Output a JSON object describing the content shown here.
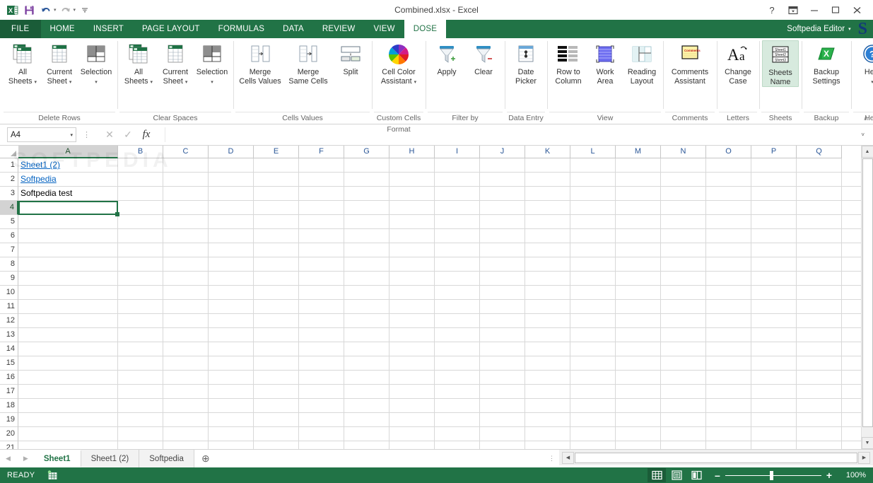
{
  "window": {
    "title": "Combined.xlsx - Excel",
    "app_icon": "excel-icon",
    "help_btn": "?",
    "ribbon_display_btn": "ribbon-display-options-icon",
    "minimize_btn": "–",
    "maximize_btn": "▫",
    "close_btn": "✕"
  },
  "quick_access": {
    "items": [
      {
        "name": "save-icon",
        "glyph": "save"
      },
      {
        "name": "undo-icon",
        "glyph": "undo",
        "caret": "▾"
      },
      {
        "name": "redo-icon",
        "glyph": "redo",
        "caret": "▾"
      },
      {
        "name": "customize-qat-icon",
        "glyph": "customize",
        "caret": ""
      }
    ]
  },
  "ribbon_tabs": {
    "file": "FILE",
    "items": [
      {
        "label": "HOME",
        "active": false
      },
      {
        "label": "INSERT",
        "active": false
      },
      {
        "label": "PAGE LAYOUT",
        "active": false
      },
      {
        "label": "FORMULAS",
        "active": false
      },
      {
        "label": "DATA",
        "active": false
      },
      {
        "label": "REVIEW",
        "active": false
      },
      {
        "label": "VIEW",
        "active": false
      },
      {
        "label": "DOSE",
        "active": true
      }
    ],
    "user": "Softpedia Editor",
    "user_caret": "▾",
    "brand_logo": "S",
    "collapse_icon": "∧"
  },
  "ribbon_groups": [
    {
      "label": "Delete Rows",
      "items": [
        {
          "line1": "All",
          "line2": "Sheets",
          "dropdown": true,
          "icon": "all-sheets-icon"
        },
        {
          "line1": "Current",
          "line2": "Sheet",
          "dropdown": true,
          "icon": "current-sheet-icon"
        },
        {
          "line1": "Selection",
          "line2": "",
          "dropdown": true,
          "icon": "selection-icon"
        }
      ]
    },
    {
      "label": "Clear Spaces",
      "items": [
        {
          "line1": "All",
          "line2": "Sheets",
          "dropdown": true,
          "icon": "all-sheets-icon"
        },
        {
          "line1": "Current",
          "line2": "Sheet",
          "dropdown": true,
          "icon": "current-sheet-icon"
        },
        {
          "line1": "Selection",
          "line2": "",
          "dropdown": true,
          "icon": "selection-icon"
        }
      ]
    },
    {
      "label": "Cells Values",
      "items": [
        {
          "line1": "Merge",
          "line2": "Cells Values",
          "dropdown": false,
          "icon": "merge-cells-values-icon"
        },
        {
          "line1": "Merge",
          "line2": "Same Cells",
          "dropdown": false,
          "icon": "merge-same-cells-icon"
        },
        {
          "line1": "Split",
          "line2": "",
          "dropdown": false,
          "icon": "split-icon"
        }
      ]
    },
    {
      "label": "Custom Cells Format",
      "items": [
        {
          "line1": "Cell Color",
          "line2": "Assistant",
          "dropdown": true,
          "icon": "color-wheel-icon"
        }
      ]
    },
    {
      "label": "Filter by",
      "items": [
        {
          "line1": "Apply",
          "line2": "",
          "dropdown": false,
          "icon": "filter-apply-icon"
        },
        {
          "line1": "Clear",
          "line2": "",
          "dropdown": false,
          "icon": "filter-clear-icon"
        }
      ]
    },
    {
      "label": "Data Entry",
      "items": [
        {
          "line1": "Date",
          "line2": "Picker",
          "dropdown": false,
          "icon": "date-picker-icon"
        }
      ]
    },
    {
      "label": "View",
      "items": [
        {
          "line1": "Row to",
          "line2": "Column",
          "dropdown": false,
          "icon": "row-to-column-icon"
        },
        {
          "line1": "Work",
          "line2": "Area",
          "dropdown": false,
          "icon": "work-area-icon"
        },
        {
          "line1": "Reading",
          "line2": "Layout",
          "dropdown": false,
          "icon": "reading-layout-icon"
        }
      ]
    },
    {
      "label": "Comments",
      "items": [
        {
          "line1": "Comments",
          "line2": "Assistant",
          "dropdown": false,
          "icon": "comments-assistant-icon"
        }
      ]
    },
    {
      "label": "Letters",
      "items": [
        {
          "line1": "Change",
          "line2": "Case",
          "dropdown": false,
          "icon": "change-case-icon"
        }
      ]
    },
    {
      "label": "Sheets",
      "items": [
        {
          "line1": "Sheets",
          "line2": "Name",
          "dropdown": false,
          "icon": "sheets-name-icon",
          "selected": true
        }
      ]
    },
    {
      "label": "Backup",
      "items": [
        {
          "line1": "Backup",
          "line2": "Settings",
          "dropdown": false,
          "icon": "backup-settings-icon"
        }
      ]
    },
    {
      "label": "Help",
      "items": [
        {
          "line1": "Help",
          "line2": "",
          "dropdown": true,
          "icon": "help-icon"
        }
      ]
    }
  ],
  "formula_bar": {
    "name_box_value": "A4",
    "name_box_caret": "▾",
    "cancel_icon": "✕",
    "enter_icon": "✓",
    "fx_label": "fx",
    "formula_value": "",
    "expand_icon": "˅"
  },
  "grid": {
    "columns": [
      "A",
      "B",
      "C",
      "D",
      "E",
      "F",
      "G",
      "H",
      "I",
      "J",
      "K",
      "L",
      "M",
      "N",
      "O",
      "P",
      "Q"
    ],
    "selected_column": "A",
    "rows": [
      1,
      2,
      3,
      4,
      5,
      6,
      7,
      8,
      9,
      10,
      11,
      12,
      13,
      14,
      15,
      16,
      17,
      18,
      19,
      20,
      21
    ],
    "selected_row": 4,
    "cells": [
      {
        "row": 1,
        "col": "A",
        "value": "Sheet1 (2)",
        "link": true
      },
      {
        "row": 2,
        "col": "A",
        "value": "Softpedia",
        "link": true
      },
      {
        "row": 3,
        "col": "A",
        "value": "Softpedia test",
        "link": false
      }
    ],
    "active_cell": "A4",
    "watermark": "SOFTPEDIA"
  },
  "sheet_tabs": {
    "prev_icon": "◀",
    "next_icon": "▶",
    "items": [
      {
        "label": "Sheet1",
        "active": true
      },
      {
        "label": "Sheet1 (2)",
        "active": false
      },
      {
        "label": "Softpedia",
        "active": false
      }
    ],
    "add_icon": "⊕"
  },
  "status_bar": {
    "status": "READY",
    "macro_icon": "record-macro-icon",
    "views": [
      {
        "name": "normal-view-icon",
        "active": true
      },
      {
        "name": "page-layout-view-icon",
        "active": false
      },
      {
        "name": "page-break-preview-icon",
        "active": false
      }
    ],
    "zoom_out": "–",
    "zoom_in": "+",
    "zoom_level": "100%"
  },
  "colors": {
    "excel_green": "#217346",
    "dark_green": "#1a5c38",
    "link_blue": "#0563c1",
    "header_blue": "#2b5797"
  }
}
